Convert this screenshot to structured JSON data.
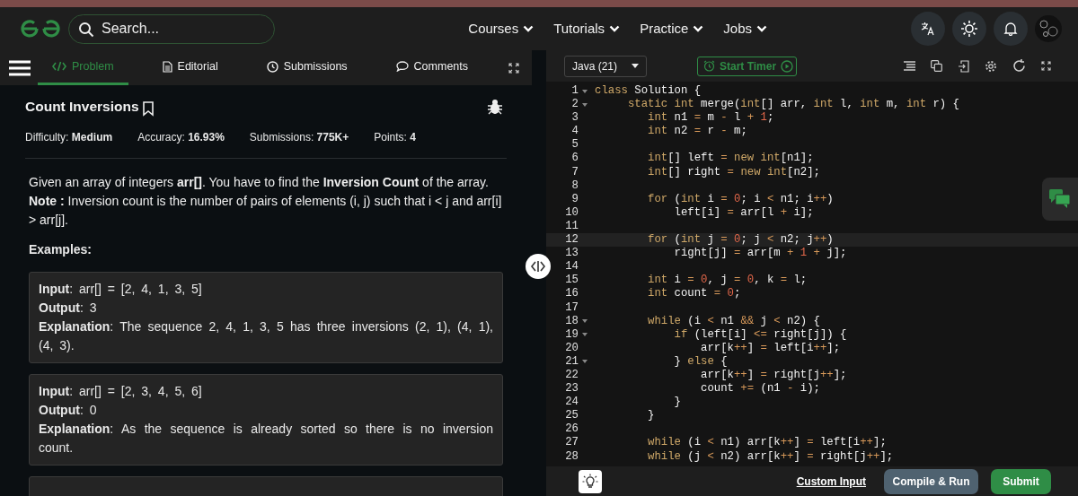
{
  "header": {
    "search": {
      "placeholder": "Search..."
    },
    "nav": [
      {
        "label": "Courses"
      },
      {
        "label": "Tutorials"
      },
      {
        "label": "Practice"
      },
      {
        "label": "Jobs"
      }
    ]
  },
  "tabs": [
    {
      "label": "Problem",
      "selected": true
    },
    {
      "label": "Editorial",
      "selected": false
    },
    {
      "label": "Submissions",
      "selected": false
    },
    {
      "label": "Comments",
      "selected": false
    }
  ],
  "problem": {
    "title": "Count Inversions",
    "meta": [
      {
        "label": "Difficulty:",
        "value": "Medium"
      },
      {
        "label": "Accuracy:",
        "value": "16.93%"
      },
      {
        "label": "Submissions:",
        "value": "775K+"
      },
      {
        "label": "Points:",
        "value": "4"
      }
    ],
    "description": [
      "Given an array of integers **arr[]**. You have to find the **Inversion Count** of the array.",
      "**Note :** Inversion count is the number of pairs of elements (i, j) such that i < j and arr[i] > arr[j]."
    ],
    "examples_heading": "Examples:",
    "examples": [
      [
        "**Input**: arr[] = [2, 4, 1, 3, 5]",
        "**Output**: 3",
        "**Explanation**: The sequence 2, 4, 1, 3, 5 has three inversions (2, 1), (4, 1), (4, 3)."
      ],
      [
        "**Input**: arr[] = [2, 3, 4, 5, 6]",
        "**Output**: 0",
        "**Explanation**: As the sequence is already sorted so there is no inversion count."
      ]
    ]
  },
  "editor": {
    "language": "Java (21)",
    "timer_button": "Start Timer",
    "lines": [
      {
        "number": "1",
        "fold": true,
        "current": false,
        "code": [
          {
            "kind": "kw",
            "text": "class"
          },
          {
            "kind": "txt",
            "text": " Solution {"
          }
        ]
      },
      {
        "number": "2",
        "fold": true,
        "current": false,
        "code": [
          {
            "kind": "kw",
            "text": "     static int"
          },
          {
            "kind": "txt",
            "text": " merge("
          },
          {
            "kind": "kw",
            "text": "int"
          },
          {
            "kind": "txt",
            "text": "[] arr, "
          },
          {
            "kind": "kw",
            "text": "int"
          },
          {
            "kind": "txt",
            "text": " l, "
          },
          {
            "kind": "kw",
            "text": "int"
          },
          {
            "kind": "txt",
            "text": " m, "
          },
          {
            "kind": "kw",
            "text": "int"
          },
          {
            "kind": "txt",
            "text": " r) {"
          }
        ]
      },
      {
        "number": "3",
        "fold": false,
        "current": false,
        "code": [
          {
            "kind": "kw",
            "text": "        int"
          },
          {
            "kind": "txt",
            "text": " n1 "
          },
          {
            "kind": "op",
            "text": "="
          },
          {
            "kind": "txt",
            "text": " m "
          },
          {
            "kind": "op",
            "text": "-"
          },
          {
            "kind": "txt",
            "text": " l "
          },
          {
            "kind": "op",
            "text": "+"
          },
          {
            "kind": "num",
            "text": " 1"
          },
          {
            "kind": "txt",
            "text": ";"
          }
        ]
      },
      {
        "number": "4",
        "fold": false,
        "current": false,
        "code": [
          {
            "kind": "kw",
            "text": "        int"
          },
          {
            "kind": "txt",
            "text": " n2 "
          },
          {
            "kind": "op",
            "text": "="
          },
          {
            "kind": "txt",
            "text": " r "
          },
          {
            "kind": "op",
            "text": "-"
          },
          {
            "kind": "txt",
            "text": " m;"
          }
        ]
      },
      {
        "number": "5",
        "fold": false,
        "current": false
      },
      {
        "number": "6",
        "fold": false,
        "current": false,
        "code": [
          {
            "kind": "kw",
            "text": "        int"
          },
          {
            "kind": "txt",
            "text": "[] left "
          },
          {
            "kind": "op",
            "text": "="
          },
          {
            "kind": "kw",
            "text": " new int"
          },
          {
            "kind": "txt",
            "text": "[n1];"
          }
        ]
      },
      {
        "number": "7",
        "fold": false,
        "current": false,
        "code": [
          {
            "kind": "kw",
            "text": "        int"
          },
          {
            "kind": "txt",
            "text": "[] right "
          },
          {
            "kind": "op",
            "text": "="
          },
          {
            "kind": "kw",
            "text": " new int"
          },
          {
            "kind": "txt",
            "text": "[n2];"
          }
        ]
      },
      {
        "number": "8",
        "fold": false,
        "current": false
      },
      {
        "number": "9",
        "fold": false,
        "current": false,
        "code": [
          {
            "kind": "kw",
            "text": "        for"
          },
          {
            "kind": "txt",
            "text": " ("
          },
          {
            "kind": "kw",
            "text": "int"
          },
          {
            "kind": "txt",
            "text": " i "
          },
          {
            "kind": "op",
            "text": "="
          },
          {
            "kind": "num",
            "text": " 0"
          },
          {
            "kind": "txt",
            "text": "; i "
          },
          {
            "kind": "op",
            "text": "<"
          },
          {
            "kind": "txt",
            "text": " n1; i"
          },
          {
            "kind": "op",
            "text": "++"
          },
          {
            "kind": "txt",
            "text": ")"
          }
        ]
      },
      {
        "number": "10",
        "fold": false,
        "current": false,
        "code": [
          {
            "kind": "txt",
            "text": "            left[i] "
          },
          {
            "kind": "op",
            "text": "="
          },
          {
            "kind": "txt",
            "text": " arr[l "
          },
          {
            "kind": "op",
            "text": "+"
          },
          {
            "kind": "txt",
            "text": " i];"
          }
        ]
      },
      {
        "number": "11",
        "fold": false,
        "current": false
      },
      {
        "number": "12",
        "fold": false,
        "current": true,
        "code": [
          {
            "kind": "kw",
            "text": "        for"
          },
          {
            "kind": "txt",
            "text": " ("
          },
          {
            "kind": "kw",
            "text": "int"
          },
          {
            "kind": "txt",
            "text": " j "
          },
          {
            "kind": "op",
            "text": "="
          },
          {
            "kind": "num",
            "text": " 0"
          },
          {
            "kind": "txt",
            "text": "; j "
          },
          {
            "kind": "op",
            "text": "<"
          },
          {
            "kind": "txt",
            "text": " n2; j"
          },
          {
            "kind": "op",
            "text": "++"
          },
          {
            "kind": "txt",
            "text": ")"
          }
        ]
      },
      {
        "number": "13",
        "fold": false,
        "current": false,
        "code": [
          {
            "kind": "txt",
            "text": "            right[j] "
          },
          {
            "kind": "op",
            "text": "="
          },
          {
            "kind": "txt",
            "text": " arr[m "
          },
          {
            "kind": "op",
            "text": "+"
          },
          {
            "kind": "num",
            "text": " 1"
          },
          {
            "kind": "op",
            "text": " +"
          },
          {
            "kind": "txt",
            "text": " j];"
          }
        ]
      },
      {
        "number": "14",
        "fold": false,
        "current": false
      },
      {
        "number": "15",
        "fold": false,
        "current": false,
        "code": [
          {
            "kind": "kw",
            "text": "        int"
          },
          {
            "kind": "txt",
            "text": " i "
          },
          {
            "kind": "op",
            "text": "="
          },
          {
            "kind": "num",
            "text": " 0"
          },
          {
            "kind": "txt",
            "text": ", j "
          },
          {
            "kind": "op",
            "text": "="
          },
          {
            "kind": "num",
            "text": " 0"
          },
          {
            "kind": "txt",
            "text": ", k "
          },
          {
            "kind": "op",
            "text": "="
          },
          {
            "kind": "txt",
            "text": " l;"
          }
        ]
      },
      {
        "number": "16",
        "fold": false,
        "current": false,
        "code": [
          {
            "kind": "kw",
            "text": "        int"
          },
          {
            "kind": "txt",
            "text": " count "
          },
          {
            "kind": "op",
            "text": "="
          },
          {
            "kind": "num",
            "text": " 0"
          },
          {
            "kind": "txt",
            "text": ";"
          }
        ]
      },
      {
        "number": "17",
        "fold": false,
        "current": false
      },
      {
        "number": "18",
        "fold": true,
        "current": false,
        "code": [
          {
            "kind": "kw",
            "text": "        while"
          },
          {
            "kind": "txt",
            "text": " (i "
          },
          {
            "kind": "op",
            "text": "<"
          },
          {
            "kind": "txt",
            "text": " n1 "
          },
          {
            "kind": "op",
            "text": "&&"
          },
          {
            "kind": "txt",
            "text": " j "
          },
          {
            "kind": "op",
            "text": "<"
          },
          {
            "kind": "txt",
            "text": " n2) {"
          }
        ]
      },
      {
        "number": "19",
        "fold": true,
        "current": false,
        "code": [
          {
            "kind": "kw",
            "text": "            if"
          },
          {
            "kind": "txt",
            "text": " (left[i] "
          },
          {
            "kind": "op",
            "text": "<="
          },
          {
            "kind": "txt",
            "text": " right[j]) {"
          }
        ]
      },
      {
        "number": "20",
        "fold": false,
        "current": false,
        "code": [
          {
            "kind": "txt",
            "text": "                arr[k"
          },
          {
            "kind": "op",
            "text": "++"
          },
          {
            "kind": "txt",
            "text": "] "
          },
          {
            "kind": "op",
            "text": "="
          },
          {
            "kind": "txt",
            "text": " left[i"
          },
          {
            "kind": "op",
            "text": "++"
          },
          {
            "kind": "txt",
            "text": "];"
          }
        ]
      },
      {
        "number": "21",
        "fold": true,
        "current": false,
        "code": [
          {
            "kind": "txt",
            "text": "            } "
          },
          {
            "kind": "kw",
            "text": "else"
          },
          {
            "kind": "txt",
            "text": " {"
          }
        ]
      },
      {
        "number": "22",
        "fold": false,
        "current": false,
        "code": [
          {
            "kind": "txt",
            "text": "                arr[k"
          },
          {
            "kind": "op",
            "text": "++"
          },
          {
            "kind": "txt",
            "text": "] "
          },
          {
            "kind": "op",
            "text": "="
          },
          {
            "kind": "txt",
            "text": " right[j"
          },
          {
            "kind": "op",
            "text": "++"
          },
          {
            "kind": "txt",
            "text": "];"
          }
        ]
      },
      {
        "number": "23",
        "fold": false,
        "current": false,
        "code": [
          {
            "kind": "txt",
            "text": "                count "
          },
          {
            "kind": "op",
            "text": "+="
          },
          {
            "kind": "txt",
            "text": " (n1 "
          },
          {
            "kind": "op",
            "text": "-"
          },
          {
            "kind": "txt",
            "text": " i);"
          }
        ]
      },
      {
        "number": "24",
        "fold": false,
        "current": false,
        "code": [
          {
            "kind": "txt",
            "text": "            }"
          }
        ]
      },
      {
        "number": "25",
        "fold": false,
        "current": false,
        "code": [
          {
            "kind": "txt",
            "text": "        }"
          }
        ]
      },
      {
        "number": "26",
        "fold": false,
        "current": false
      },
      {
        "number": "27",
        "fold": false,
        "current": false,
        "code": [
          {
            "kind": "kw",
            "text": "        while"
          },
          {
            "kind": "txt",
            "text": " (i "
          },
          {
            "kind": "op",
            "text": "<"
          },
          {
            "kind": "txt",
            "text": " n1) arr[k"
          },
          {
            "kind": "op",
            "text": "++"
          },
          {
            "kind": "txt",
            "text": "] "
          },
          {
            "kind": "op",
            "text": "="
          },
          {
            "kind": "txt",
            "text": " left[i"
          },
          {
            "kind": "op",
            "text": "++"
          },
          {
            "kind": "txt",
            "text": "];"
          }
        ]
      },
      {
        "number": "28",
        "fold": false,
        "current": false,
        "code": [
          {
            "kind": "kw",
            "text": "        while"
          },
          {
            "kind": "txt",
            "text": " (j "
          },
          {
            "kind": "op",
            "text": "<"
          },
          {
            "kind": "txt",
            "text": " n2) arr[k"
          },
          {
            "kind": "op",
            "text": "++"
          },
          {
            "kind": "txt",
            "text": "] "
          },
          {
            "kind": "op",
            "text": "="
          },
          {
            "kind": "txt",
            "text": " right[j"
          },
          {
            "kind": "op",
            "text": "++"
          },
          {
            "kind": "txt",
            "text": "];"
          }
        ]
      }
    ]
  },
  "footer": {
    "custom_input": "Custom Input",
    "run_button": "Compile & Run",
    "submit_button": "Submit"
  }
}
